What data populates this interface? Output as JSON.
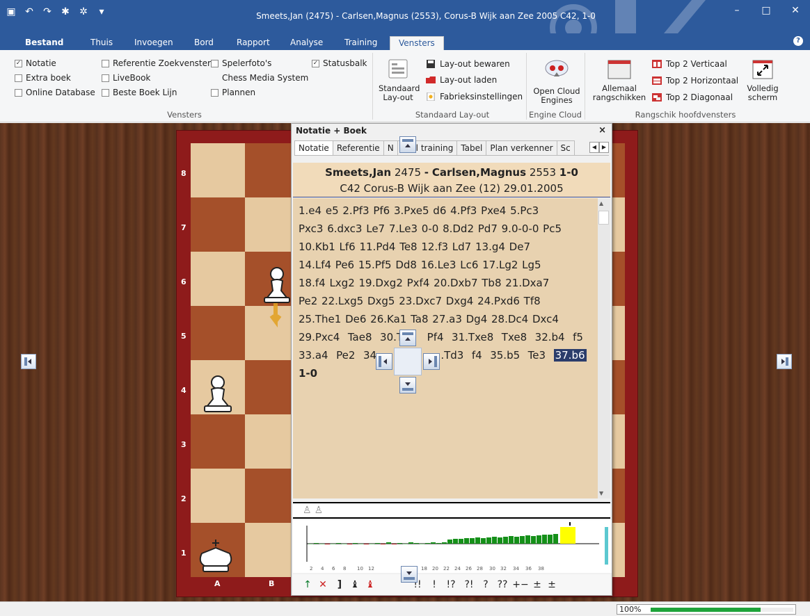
{
  "window": {
    "title": "Smeets,Jan (2475) - Carlsen,Magnus (2553), Corus-B Wijk aan Zee 2005  C42, 1-0"
  },
  "ribbon_tabs": [
    "Bestand",
    "Thuis",
    "Invoegen",
    "Bord",
    "Rapport",
    "Analyse",
    "Training",
    "Vensters"
  ],
  "active_tab": "Vensters",
  "ribbon": {
    "vensters_group": {
      "label": "Vensters",
      "checkboxes": [
        {
          "label": "Notatie",
          "checked": true
        },
        {
          "label": "Extra boek",
          "checked": false
        },
        {
          "label": "Online Database",
          "checked": false
        },
        {
          "label": "Referentie Zoekvenster",
          "checked": false
        },
        {
          "label": "LiveBook",
          "checked": false
        },
        {
          "label": "Beste Boek Lijn",
          "checked": false
        },
        {
          "label": "Spelerfoto's",
          "checked": false
        },
        {
          "label": "Chess Media System",
          "checked": false
        },
        {
          "label": "Plannen",
          "checked": false
        },
        {
          "label": "Statusbalk",
          "checked": true
        }
      ]
    },
    "layout_group": {
      "label": "Standaard Lay-out",
      "big_button": "Standaard Lay-out",
      "buttons": [
        "Lay-out bewaren",
        "Lay-out laden",
        "Fabrieksinstellingen"
      ]
    },
    "cloud_group": {
      "label": "Engine Cloud",
      "big_button": "Open Cloud Engines"
    },
    "arrange_group": {
      "label": "Rangschik hoofdvensters",
      "big_button": "Allemaal rangschikken",
      "buttons": [
        "Top 2 Verticaal",
        "Top 2 Horizontaal",
        "Top 2 Diagonaal"
      ],
      "fullscreen": "Volledig scherm"
    }
  },
  "board": {
    "ranks": [
      "8",
      "7",
      "6",
      "5",
      "4",
      "3",
      "2",
      "1"
    ],
    "files": [
      "A",
      "B"
    ]
  },
  "panel": {
    "title": "Notatie + Boek",
    "close": "×",
    "tabs": [
      "Notatie",
      "Referentie",
      "N",
      "l training",
      "Tabel",
      "Plan verkenner",
      "Sc"
    ],
    "header_line1": {
      "white": "Smeets,Jan",
      "white_elo": "2475",
      "sep": "-",
      "black": "Carlsen,Magnus",
      "black_elo": "2553",
      "result": "1-0"
    },
    "header_line2": "C42 Corus-B Wijk aan Zee (12) 29.01.2005",
    "notation_lines": [
      "1.e4  e5  2.Pf3  Pf6  3.Pxe5  d6  4.Pf3  Pxe4  5.Pc3",
      "Pxc3  6.dxc3  Le7  7.Le3  0-0  8.Dd2  Pd7  9.0-0-0  Pc5",
      "10.Kb1  Lf6  11.Pd4  Te8  12.f3  Ld7  13.g4  De7",
      "14.Lf4  Pe6  15.Pf5  Dd8  16.Le3  Lc6  17.Lg2  Lg5",
      "18.f4  Lxg2  19.Dxg2  Pxf4  20.Dxb7  Tb8  21.Dxa7",
      "Pe2  22.Lxg5  Dxg5  23.Dxc7  Dxg4  24.Pxd6  Tf8",
      "25.The1  De6  26.Ka1  Ta8  27.a3  Dg4  28.Dc4  Dxc4",
      "29.Pxc4  Tae8  30.T      Pf4  31.Txe8  Txe8  32.b4  f5",
      "33.a4  Pe2  34                .Td3  f4  35.b5  Te3  "
    ],
    "current_move": "37.b6",
    "result": "1-0",
    "eval_ticks": [
      "2",
      "4",
      "6",
      "8",
      "10",
      "12",
      "18",
      "20",
      "22",
      "24",
      "26",
      "28",
      "30",
      "32",
      "34",
      "36",
      "38"
    ],
    "annotations": [
      "↑",
      "✕",
      "]",
      "♝",
      "♝",
      "!!",
      "!",
      "!?",
      "?!",
      "?",
      "??",
      "+−",
      "±",
      "±"
    ]
  },
  "status": {
    "zoom_label": "100%",
    "zoom_fraction": 0.77
  }
}
